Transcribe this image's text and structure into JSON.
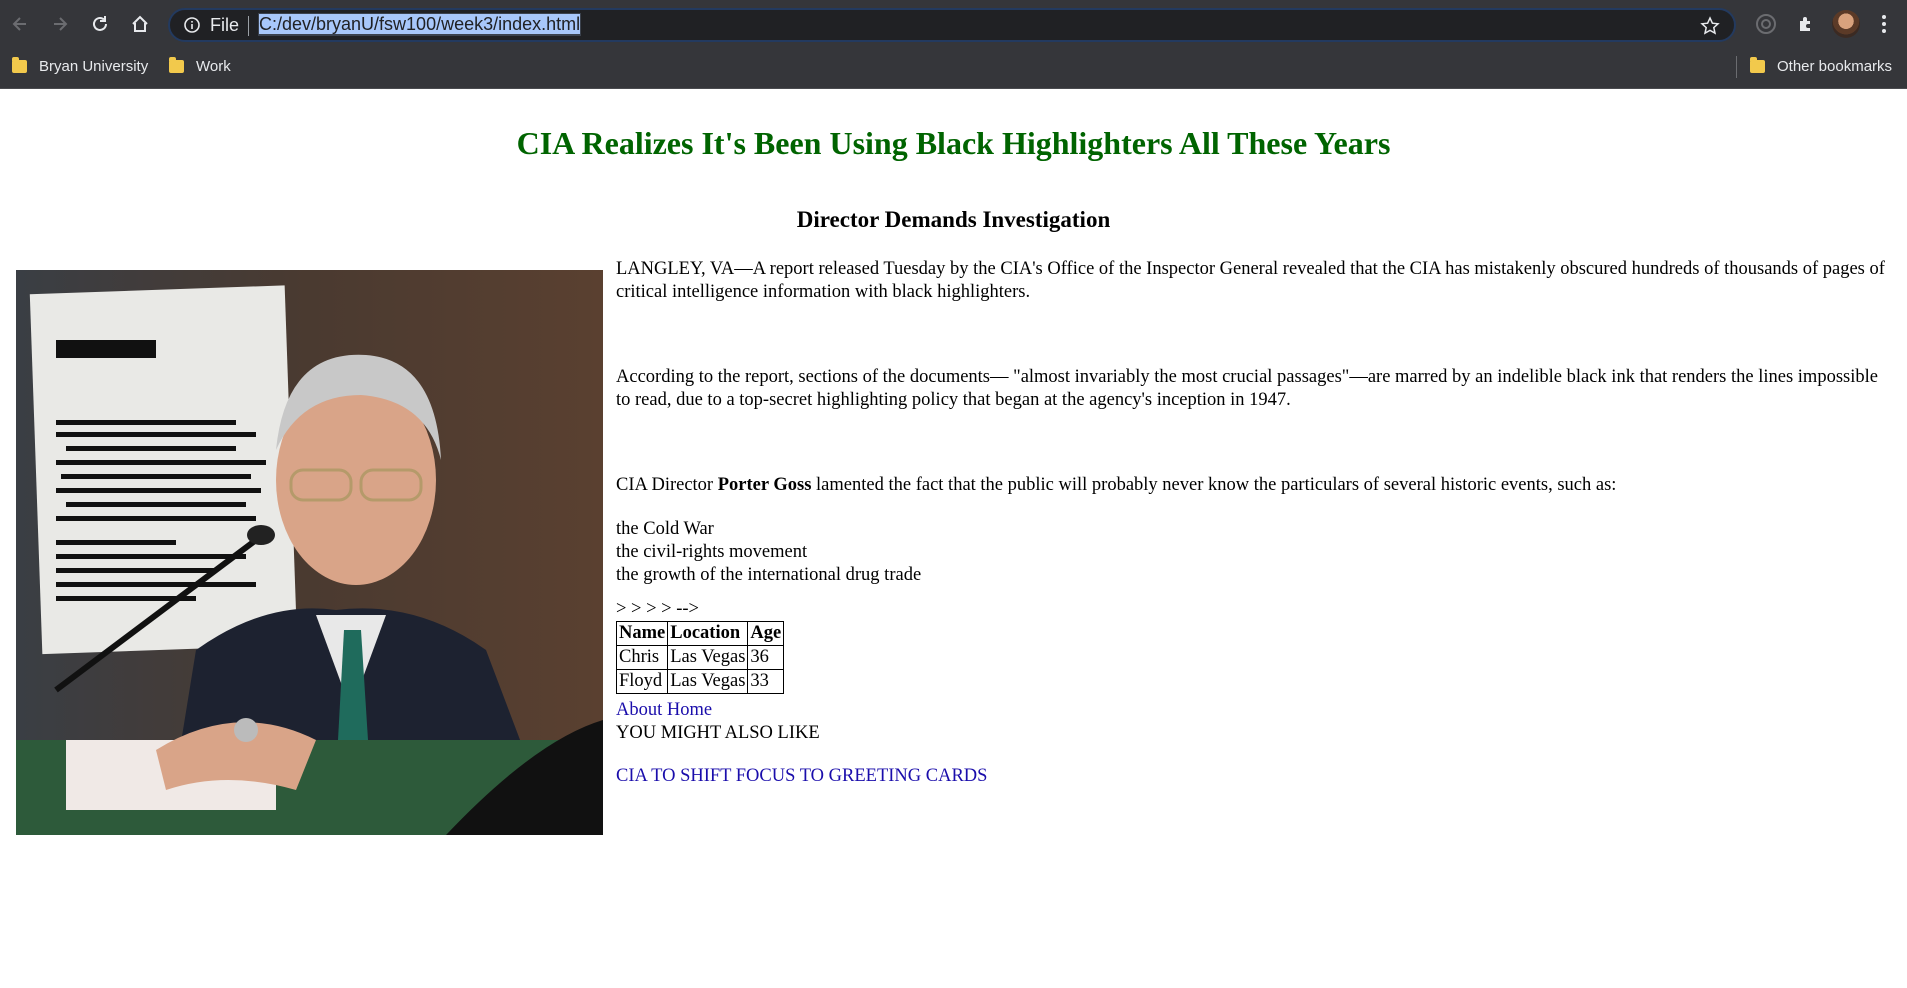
{
  "browser": {
    "scheme": "File",
    "url": "C:/dev/bryanU/fsw100/week3/index.html",
    "bookmarks": [
      {
        "label": "Bryan University"
      },
      {
        "label": "Work"
      }
    ],
    "other_bookmarks": "Other bookmarks"
  },
  "article": {
    "headline": "CIA Realizes It's Been Using Black Highlighters All These Years",
    "subheadline": "Director Demands Investigation",
    "p1": "LANGLEY, VA—A report released Tuesday by the CIA's Office of the Inspector General revealed that the CIA has mistakenly obscured hundreds of thousands of pages of critical intelligence information with black highlighters.",
    "p2": "According to the report, sections of the documents— \"almost invariably the most crucial passages\"—are marred by an indelible black ink that renders the lines impossible to read, due to a top-secret highlighting policy that began at the agency's inception in 1947.",
    "p3_before": "CIA Director ",
    "p3_name": "Porter Goss",
    "p3_after": " lamented the fact that the public will probably never know the particulars of several historic events, such as:",
    "events": [
      "the Cold War",
      "the civil-rights movement",
      "the growth of the international drug trade"
    ],
    "stray_text": "> > > > -->",
    "table": {
      "headers": [
        "Name",
        "Location",
        "Age"
      ],
      "rows": [
        [
          "Chris",
          "Las Vegas",
          "36"
        ],
        [
          "Floyd",
          "Las Vegas",
          "33"
        ]
      ]
    },
    "links": [
      "About",
      "Home"
    ],
    "also_like": "YOU MIGHT ALSO LIKE",
    "related_link": "CIA TO SHIFT FOCUS TO GREETING CARDS"
  },
  "colors": {
    "headline": "#006400",
    "link": "#1a0dab",
    "chrome": "#35363a"
  }
}
